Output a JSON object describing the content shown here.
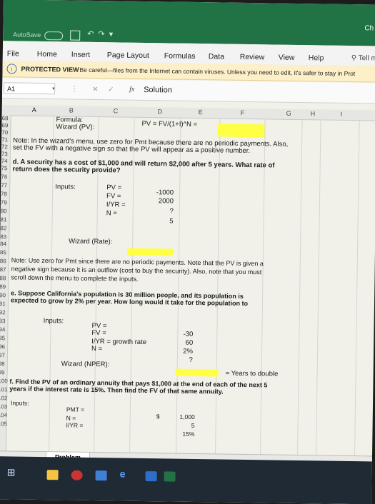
{
  "titlebar": {
    "autosave": "AutoSave",
    "toggle_state": "Off",
    "right_text": "Ch"
  },
  "ribbon": {
    "tabs": [
      "File",
      "Home",
      "Insert",
      "Page Layout",
      "Formulas",
      "Data",
      "Review",
      "View",
      "Help"
    ],
    "tell_me": "Tell me"
  },
  "protected_view": {
    "title": "PROTECTED VIEW",
    "message": "Be careful—files from the Internet can contain viruses. Unless you need to edit, it's safer to stay in Prot"
  },
  "formula_bar": {
    "name_box": "A1",
    "fx": "fx",
    "content": "Solution"
  },
  "columns": [
    "A",
    "B",
    "C",
    "D",
    "E",
    "F",
    "G",
    "H",
    "I"
  ],
  "sheet": {
    "r68_B": "Formula:",
    "r68_D": "PV = FV/(1+I)^N =",
    "r69_B": "Wizard (PV):",
    "r71": "Note:  In the wizard's menu, use zero for Pmt because there are no periodic payments.  Also,",
    "r72": "set the FV with a negative sign so that the PV will appear as a positive number.",
    "r74": "d.  A security has a cost of $1,000 and will return $2,000 after 5 years.  What rate of",
    "r75": "return does the security provide?",
    "r78_label": "Inputs:",
    "r78_C": "PV  =",
    "r78_D": "-1000",
    "r79_C": "FV  =",
    "r79_D": "2000",
    "r80_C": "I/YR  =",
    "r80_D": "?",
    "r81_C": "N  =",
    "r81_D": "5",
    "r82_B": "Wizard (Rate):",
    "r84": "Note:  Use zero for Pmt since there are no periodic payments.  Note that the PV is given a",
    "r85": "negative sign because it is an outflow (cost to buy the security).  Also, note that you must",
    "r86": "scroll down the menu to complete the inputs.",
    "r88": "e.  Suppose California's population is 30 million people, and its population is",
    "r89": "expected to grow by 2% per year.  How long would it take for the population to",
    "r91_label": "Inputs:",
    "r92_C": "PV  =",
    "r93_C": "FV  =",
    "r93_D": "-30",
    "r94_C": "I/YR  =  growth rate",
    "r94_D": "60",
    "r95_C": "N  =",
    "r95_D": "2%",
    "r96_D": "?",
    "r97_B": "Wizard (NPER):",
    "r98_E": "= Years to double",
    "r99": "f.  Find the PV of an ordinary annuity that pays $1,000 at the end of each of the next 5",
    "r100": "years if the interest rate is 15%.  Then find the FV of that same annuity.",
    "r102_label": "Inputs:",
    "r103_C": "PMT =",
    "r103_D_cur": "$",
    "r103_D": "1,000",
    "r104_C": "N =",
    "r104_D": "5",
    "r105_C": "I/YR =",
    "r105_D": "15%"
  },
  "row_numbers": [
    "68",
    "69",
    "70",
    "71",
    "72",
    "73",
    "74",
    "75",
    "76",
    "77",
    "78",
    "79",
    "80",
    "81",
    "82",
    "83",
    "84",
    "85",
    "86",
    "87",
    "88",
    "89",
    "90",
    "91",
    "92",
    "93",
    "94",
    "95",
    "96",
    "97",
    "98",
    "99",
    "100",
    "101",
    "102",
    "103",
    "104",
    "105"
  ],
  "sheet_tab": "Problem",
  "colors": {
    "title_bar": "#217346",
    "highlight": "#ffff44",
    "protected_bar": "#fdf0c8"
  }
}
